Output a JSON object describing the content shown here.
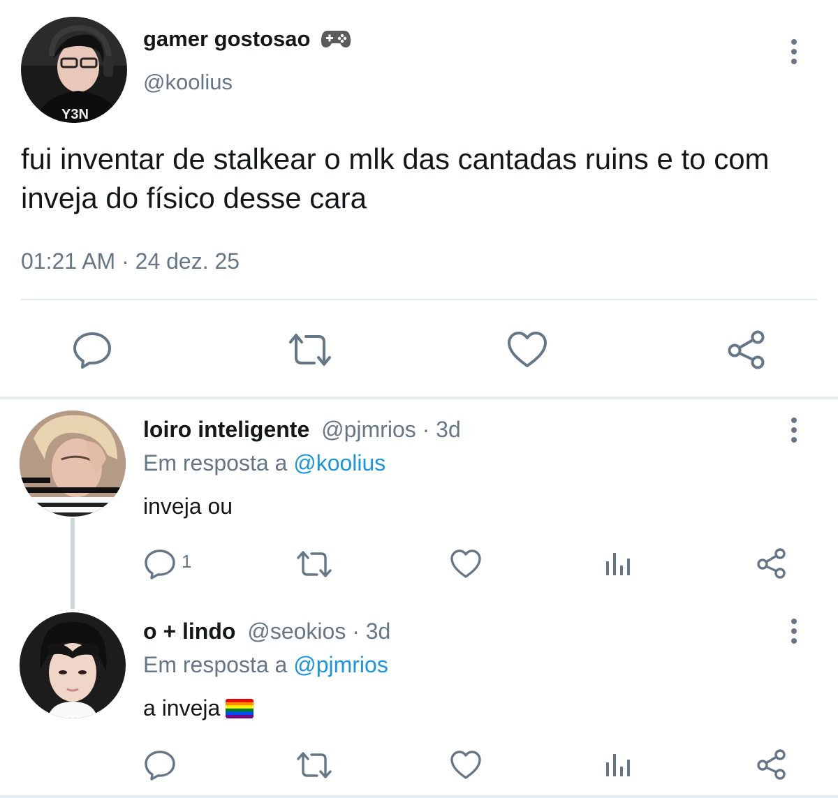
{
  "main_tweet": {
    "display_name": "gamer gostosao",
    "name_emoji": "🎮",
    "handle": "@koolius",
    "text": "fui inventar de stalkear o mlk das cantadas ruins e to com inveja do físico desse cara",
    "time": "01:21 AM",
    "separator": " · ",
    "date": "24 dez. 25",
    "actions": [
      "reply-icon",
      "retweet-icon",
      "like-icon",
      "share-icon"
    ]
  },
  "replies": [
    {
      "display_name": "loiro inteligente",
      "handle": "@pjmrios",
      "age": " · 3d",
      "in_reply_prefix": "Em resposta a ",
      "in_reply_handle": "@koolius",
      "text": "inveja ou",
      "reply_count": "1",
      "actions": [
        "reply-icon",
        "retweet-icon",
        "like-icon",
        "analytics-icon",
        "share-icon"
      ]
    },
    {
      "display_name": "o + lindo",
      "handle": "@seokios",
      "age": " · 3d",
      "in_reply_prefix": "Em resposta a ",
      "in_reply_handle": "@pjmrios",
      "text": "a inveja",
      "text_emoji": "rainbow-flag-icon",
      "reply_count": "",
      "actions": [
        "reply-icon",
        "retweet-icon",
        "like-icon",
        "analytics-icon",
        "share-icon"
      ]
    }
  ],
  "colors": {
    "text": "#14171a",
    "secondary": "#657786",
    "link": "#1b95e0",
    "divider": "#e1e8ed",
    "icon": "#657786"
  }
}
